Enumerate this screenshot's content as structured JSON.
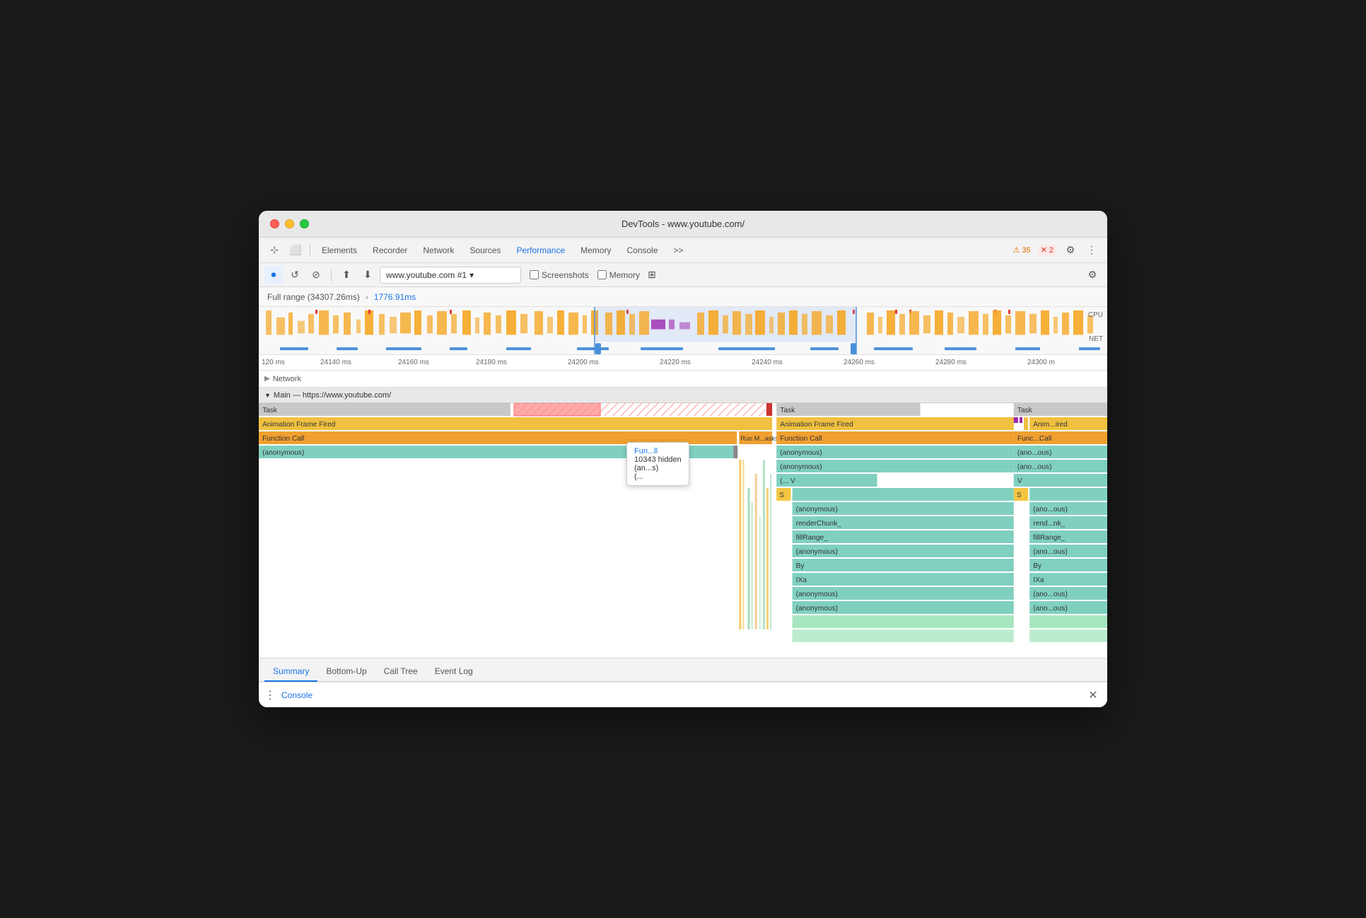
{
  "window": {
    "title": "DevTools - www.youtube.com/"
  },
  "nav": {
    "tabs": [
      {
        "id": "elements",
        "label": "Elements"
      },
      {
        "id": "recorder",
        "label": "Recorder"
      },
      {
        "id": "network",
        "label": "Network"
      },
      {
        "id": "sources",
        "label": "Sources"
      },
      {
        "id": "performance",
        "label": "Performance"
      },
      {
        "id": "memory",
        "label": "Memory"
      },
      {
        "id": "console",
        "label": "Console"
      },
      {
        "id": "more",
        "label": ">>"
      }
    ],
    "active_tab": "performance",
    "warnings": {
      "icon": "⚠",
      "count": "35"
    },
    "errors": {
      "count": "2"
    }
  },
  "toolbar": {
    "url": "www.youtube.com #1",
    "screenshots_label": "Screenshots",
    "memory_label": "Memory"
  },
  "range": {
    "full_label": "Full range (34307.26ms)",
    "selected_label": "1776.91ms"
  },
  "timeline": {
    "cpu_label": "CPU",
    "net_label": "NET",
    "scale_marks": [
      "120 ms",
      "24140 ms",
      "24160 ms",
      "24180 ms",
      "24200 ms",
      "24220 ms",
      "24240 ms",
      "24260 ms",
      "24280 ms",
      "24300 m"
    ]
  },
  "flame_chart": {
    "section_label": "Main — https://www.youtube.com/",
    "rows": [
      {
        "label": "Task",
        "type": "header"
      },
      {
        "label": "Animation Frame Fired",
        "color": "#f0c040"
      },
      {
        "label": "Function Call",
        "color": "#f0a030"
      },
      {
        "label": "(anonymous)",
        "color": "#80d0c0"
      }
    ],
    "right_section": {
      "task1": "Task",
      "animation1": "Animation Frame Fired",
      "func1": "Function Call",
      "anon1": "(anonymous)",
      "anon2": "(anonymous)",
      "dots": "(... V",
      "s_block": "S",
      "anon3": "(anonymous)",
      "renderChunk": "renderChunk_",
      "fillRange": "fillRange_",
      "anon4": "(anonymous)",
      "by": "By",
      "ixa": "IXa",
      "anon5": "(anonymous)",
      "anon6": "(anonymous)"
    },
    "far_right_section": {
      "task": "Task",
      "anim": "Anim...ired",
      "func": "Func...Call",
      "anon1": "(ano...ous)",
      "anon2": "(ano...ous)",
      "v": "V",
      "s": "S",
      "anon3": "(ano...ous)",
      "rend": "rend...nk_",
      "fillRange": "fillRange_",
      "anon4": "(ano...ous)",
      "by": "By",
      "ixa": "IXa",
      "anon5": "(ano...ous)",
      "anon6": "(ano...ous)"
    },
    "tooltip": {
      "label1": "Fun...ll",
      "label2": "10343 hidden",
      "label3": "(an...s)",
      "label4": "(..."
    },
    "run_tasks": "Run M...asks"
  },
  "bottom_tabs": {
    "tabs": [
      {
        "id": "summary",
        "label": "Summary"
      },
      {
        "id": "bottom-up",
        "label": "Bottom-Up"
      },
      {
        "id": "call-tree",
        "label": "Call Tree"
      },
      {
        "id": "event-log",
        "label": "Event Log"
      }
    ],
    "active": "summary"
  },
  "console_bar": {
    "label": "Console",
    "close_icon": "✕"
  }
}
